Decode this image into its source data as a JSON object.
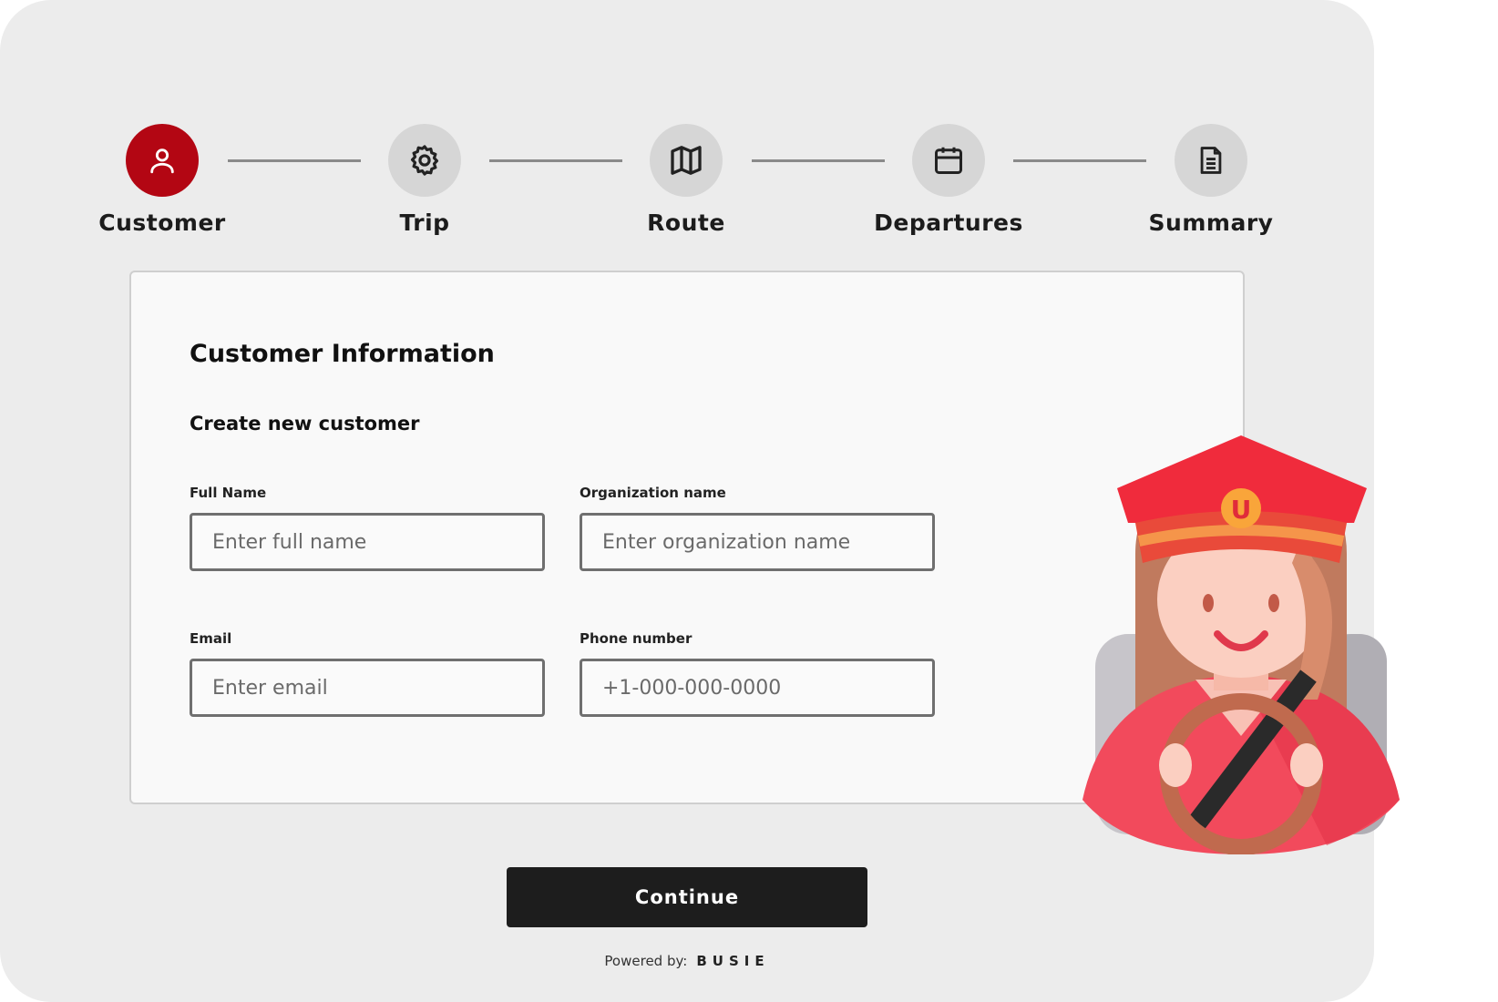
{
  "stepper": {
    "steps": [
      {
        "label": "Customer",
        "icon": "user-icon",
        "active": true
      },
      {
        "label": "Trip",
        "icon": "gear-icon",
        "active": false
      },
      {
        "label": "Route",
        "icon": "map-icon",
        "active": false
      },
      {
        "label": "Departures",
        "icon": "calendar-icon",
        "active": false
      },
      {
        "label": "Summary",
        "icon": "document-icon",
        "active": false
      }
    ],
    "active_color": "#b30613"
  },
  "form": {
    "title": "Customer Information",
    "subtitle": "Create new customer",
    "full_name": {
      "label": "Full Name",
      "placeholder": "Enter full name"
    },
    "organization": {
      "label": "Organization name",
      "placeholder": "Enter organization name"
    },
    "email": {
      "label": "Email",
      "placeholder": "Enter email"
    },
    "phone": {
      "label": "Phone number",
      "placeholder": "+1-000-000-0000"
    }
  },
  "actions": {
    "continue_label": "Continue"
  },
  "footer": {
    "powered_by": "Powered by:",
    "brand": "BUSIE"
  }
}
